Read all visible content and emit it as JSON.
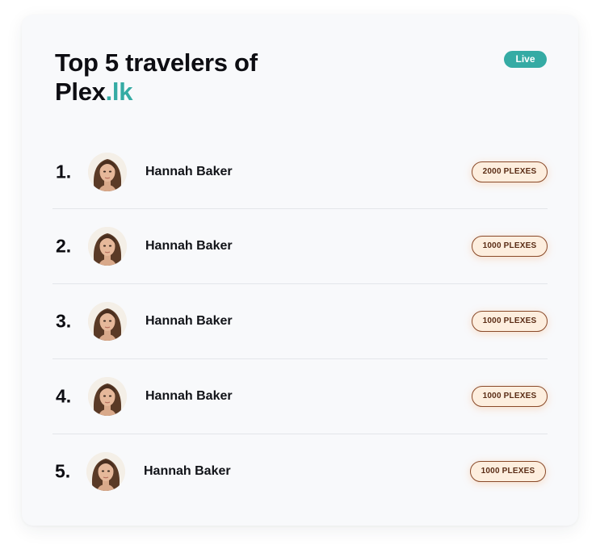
{
  "header": {
    "title_line1": "Top 5 travelers of",
    "title_brand": "Plex",
    "title_brand_accent": ".lk",
    "status_badge": "Live"
  },
  "travelers": [
    {
      "rank": "1.",
      "name": "Hannah Baker",
      "points": "2000 PLEXES"
    },
    {
      "rank": "2.",
      "name": "Hannah Baker",
      "points": "1000 PLEXES"
    },
    {
      "rank": "3.",
      "name": "Hannah Baker",
      "points": "1000 PLEXES"
    },
    {
      "rank": "4.",
      "name": "Hannah Baker",
      "points": "1000 PLEXES"
    },
    {
      "rank": "5.",
      "name": "Hannah Baker",
      "points": "1000 PLEXES"
    }
  ],
  "colors": {
    "accent": "#35aba4",
    "pill_background": "#fdeede",
    "pill_border": "#8a4a2a",
    "card_background": "#f8f9fb"
  },
  "icons": {
    "avatar": "user-avatar-photo"
  }
}
